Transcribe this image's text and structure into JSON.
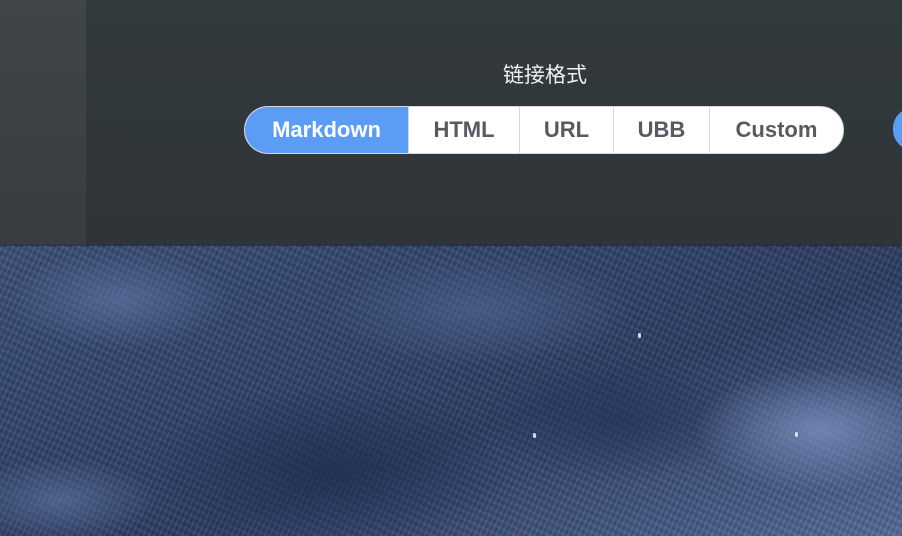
{
  "settings": {
    "link_format_label": "链接格式",
    "formats": [
      {
        "label": "Markdown",
        "selected": true
      },
      {
        "label": "HTML",
        "selected": false
      },
      {
        "label": "URL",
        "selected": false
      },
      {
        "label": "UBB",
        "selected": false
      },
      {
        "label": "Custom",
        "selected": false
      }
    ]
  },
  "colors": {
    "accent": "#5b9cf4",
    "window_bg": "#2f3538",
    "sidebar_bg": "#3d4145",
    "title_text": "#eef1f3",
    "segment_text": "#555b60"
  }
}
